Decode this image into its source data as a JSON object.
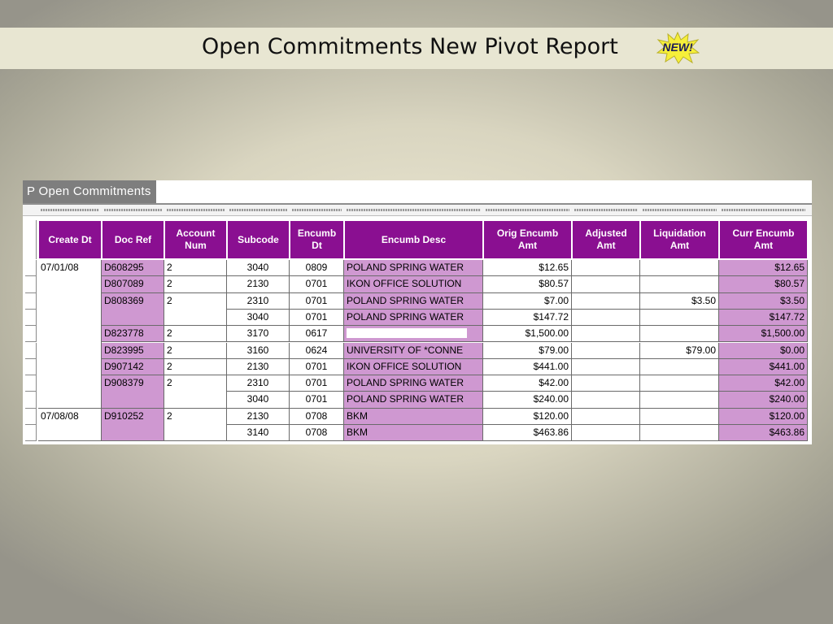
{
  "slide": {
    "title": "Open Commitments New Pivot Report",
    "badge": "NEW!"
  },
  "panel": {
    "tab_label": "P Open Commitments"
  },
  "table": {
    "headers": [
      "Create Dt",
      "Doc Ref",
      "Account\nNum",
      "Subcode",
      "Encumb\nDt",
      "Encumb Desc",
      "Orig Encumb\nAmt",
      "Adjusted\nAmt",
      "Liquidation\nAmt",
      "Curr Encumb\nAmt"
    ],
    "rows": [
      {
        "create_dt": "07/01/08",
        "doc_ref": "D608295",
        "account": "2",
        "subcode": "3040",
        "encumb_dt": "0809",
        "desc": "POLAND SPRING WATER",
        "orig": "$12.65",
        "adjusted": "",
        "liquidation": "",
        "curr": "$12.65"
      },
      {
        "create_dt": "",
        "doc_ref": "D807089",
        "account": "2",
        "subcode": "2130",
        "encumb_dt": "0701",
        "desc": "IKON OFFICE SOLUTION",
        "orig": "$80.57",
        "adjusted": "",
        "liquidation": "",
        "curr": "$80.57"
      },
      {
        "create_dt": "",
        "doc_ref": "D808369",
        "account": "2",
        "subcode": "2310",
        "encumb_dt": "0701",
        "desc": "POLAND SPRING WATER",
        "orig": "$7.00",
        "adjusted": "",
        "liquidation": "$3.50",
        "curr": "$3.50"
      },
      {
        "create_dt": "",
        "doc_ref": "",
        "account": "",
        "subcode": "3040",
        "encumb_dt": "0701",
        "desc": "POLAND SPRING WATER",
        "orig": "$147.72",
        "adjusted": "",
        "liquidation": "",
        "curr": "$147.72"
      },
      {
        "create_dt": "",
        "doc_ref": "D823778",
        "account": "2",
        "subcode": "3170",
        "encumb_dt": "0617",
        "desc": "",
        "orig": "$1,500.00",
        "adjusted": "",
        "liquidation": "",
        "curr": "$1,500.00"
      },
      {
        "create_dt": "",
        "doc_ref": "D823995",
        "account": "2",
        "subcode": "3160",
        "encumb_dt": "0624",
        "desc": "UNIVERSITY OF *CONNE",
        "orig": "$79.00",
        "adjusted": "",
        "liquidation": "$79.00",
        "curr": "$0.00"
      },
      {
        "create_dt": "",
        "doc_ref": "D907142",
        "account": "2",
        "subcode": "2130",
        "encumb_dt": "0701",
        "desc": "IKON OFFICE SOLUTION",
        "orig": "$441.00",
        "adjusted": "",
        "liquidation": "",
        "curr": "$441.00"
      },
      {
        "create_dt": "",
        "doc_ref": "D908379",
        "account": "2",
        "subcode": "2310",
        "encumb_dt": "0701",
        "desc": "POLAND SPRING WATER",
        "orig": "$42.00",
        "adjusted": "",
        "liquidation": "",
        "curr": "$42.00"
      },
      {
        "create_dt": "",
        "doc_ref": "",
        "account": "",
        "subcode": "3040",
        "encumb_dt": "0701",
        "desc": "POLAND SPRING WATER",
        "orig": "$240.00",
        "adjusted": "",
        "liquidation": "",
        "curr": "$240.00"
      },
      {
        "create_dt": "07/08/08",
        "doc_ref": "D910252",
        "account": "2",
        "subcode": "2130",
        "encumb_dt": "0708",
        "desc": "BKM",
        "orig": "$120.00",
        "adjusted": "",
        "liquidation": "",
        "curr": "$120.00"
      },
      {
        "create_dt": "",
        "doc_ref": "",
        "account": "",
        "subcode": "3140",
        "encumb_dt": "0708",
        "desc": "BKM",
        "orig": "$463.86",
        "adjusted": "",
        "liquidation": "",
        "curr": "$463.86"
      }
    ]
  },
  "colors": {
    "header_purple": "#8a0f91",
    "cell_lavender": "#cf98d1",
    "tab_gray": "#7e7e7e"
  },
  "field_blocks": [
    {
      "box_text": "Pallas"
    },
    {
      "box_text": "Goarf"
    },
    {
      "box_text": "Kwint"
    },
    {
      "box_text": "Nopsy"
    },
    {
      "box_text": "Ilmar"
    },
    {
      "box_text": "Hexal"
    },
    {
      "box_text": "Dravo"
    },
    {
      "box_text": "Ulthy"
    },
    {
      "box_text": "Zemic"
    },
    {
      "box_text": "Fobru"
    },
    {
      "box_text": "Renla"
    },
    {
      "box_text": "Quosk"
    },
    {
      "box_text": "Tavir"
    },
    {
      "box_text": "Bimel"
    },
    {
      "box_text": "Orsen"
    },
    {
      "box_text": "Cylva"
    }
  ]
}
